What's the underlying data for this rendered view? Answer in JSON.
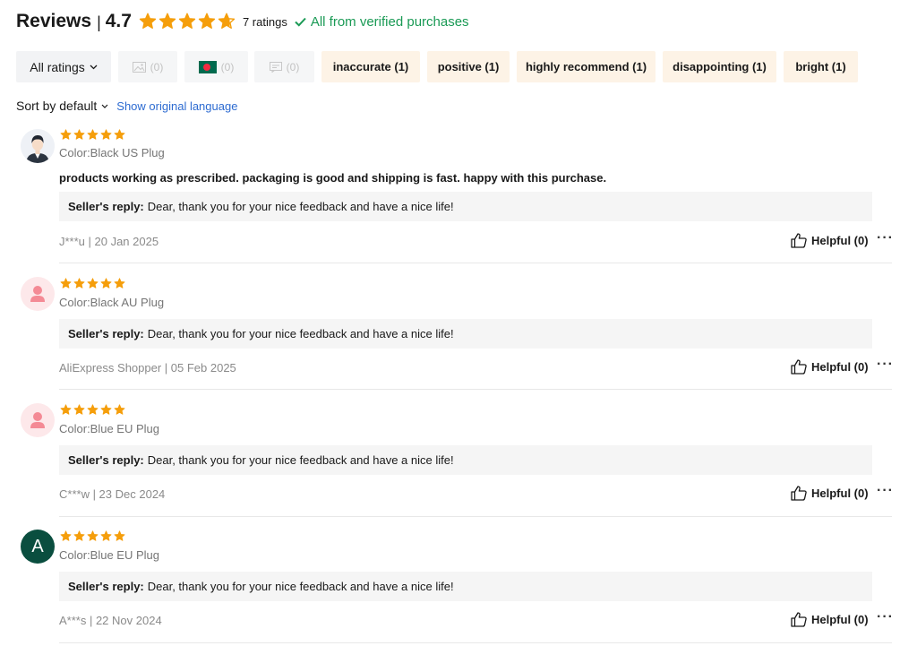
{
  "header": {
    "title": "Reviews",
    "separator": "|",
    "average_rating": "4.7",
    "average_rating_value": 4.7,
    "rating_count": "7 ratings",
    "verified_text": "All from verified purchases",
    "star_color": "#f59e0b",
    "verified_color": "#1a9a55"
  },
  "filters": {
    "all_ratings": "All ratings",
    "image_filter_count": "(0)",
    "flag_filter_count": "(0)",
    "comment_filter_count": "(0)",
    "tags": [
      {
        "label": "inaccurate (1)"
      },
      {
        "label": "positive (1)"
      },
      {
        "label": "highly recommend (1)"
      },
      {
        "label": "disappointing (1)"
      },
      {
        "label": "bright (1)"
      }
    ]
  },
  "sort": {
    "label": "Sort by default",
    "language_link": "Show original language"
  },
  "reviews": [
    {
      "stars": 5,
      "avatar": "man-avatar-icon",
      "color": "Color:Black US Plug",
      "text": "products working as prescribed. packaging is good and shipping is fast. happy with this purchase.",
      "reply_label": "Seller's reply:",
      "reply_text": "Dear, thank you for your nice feedback and have a nice life!",
      "meta": "J***u | 20 Jan 2025",
      "helpful": "Helpful (0)",
      "more": "···"
    },
    {
      "stars": 5,
      "avatar": "person-silhouette-icon",
      "color": "Color:Black AU Plug",
      "reply_label": "Seller's reply:",
      "reply_text": "Dear, thank you for your nice feedback and have a nice life!",
      "meta": "AliExpress Shopper | 05 Feb 2025",
      "helpful": "Helpful (0)",
      "more": "···"
    },
    {
      "stars": 5,
      "avatar": "person-silhouette-icon",
      "color": "Color:Blue EU Plug",
      "reply_label": "Seller's reply:",
      "reply_text": "Dear, thank you for your nice feedback and have a nice life!",
      "meta": "C***w | 23 Dec 2024",
      "helpful": "Helpful (0)",
      "more": "···"
    },
    {
      "stars": 5,
      "avatar_letter": "A",
      "color": "Color:Blue EU Plug",
      "reply_label": "Seller's reply:",
      "reply_text": "Dear, thank you for your nice feedback and have a nice life!",
      "meta": "A***s | 22 Nov 2024",
      "helpful": "Helpful (0)",
      "more": "···"
    }
  ]
}
